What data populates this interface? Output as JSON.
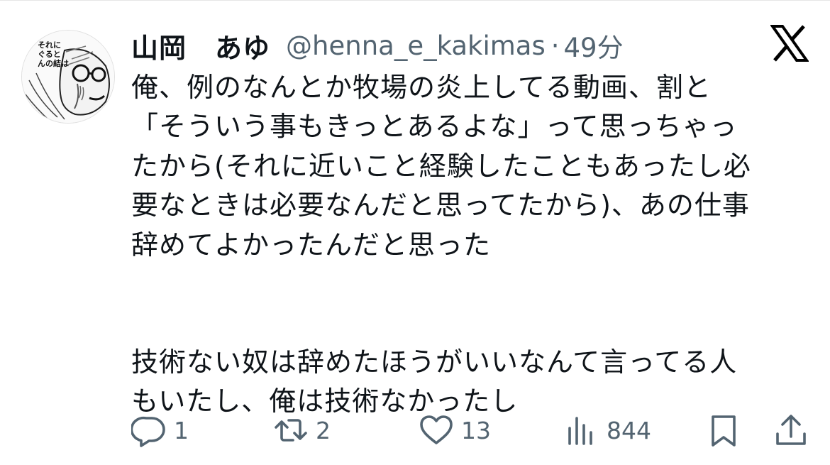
{
  "author": {
    "display_name_part1": "山岡",
    "display_name_part2": "あゆ",
    "handle": "@henna_e_kakimas",
    "separator": "·",
    "timestamp": "49分",
    "avatar_caption": "それに\nぐると\nんの結は"
  },
  "tweet": {
    "lines": [
      "俺、例のなんとか牧場の炎上してる動画、割と",
      "「そういう事もきっとあるよな」って思っちゃっ",
      "たから(それに近いこと経験したこともあったし必",
      "要なときは必要なんだと思ってたから)、あの仕事",
      "辞めてよかったんだと思った",
      "技術ない奴は辞めたほうがいいなんて言ってる人",
      "もいたし、俺は技術なかったし"
    ]
  },
  "actions": {
    "replies": "1",
    "reposts": "2",
    "likes": "13",
    "views": "844"
  },
  "icons": {
    "platform_logo": "x-logo-icon",
    "reply": "reply-bubble-icon",
    "repost": "repost-icon",
    "like": "heart-icon",
    "views": "bar-chart-icon",
    "bookmark": "bookmark-icon",
    "share": "share-icon"
  },
  "colors": {
    "text": "#0f1419",
    "secondary": "#536471",
    "background": "#ffffff"
  }
}
